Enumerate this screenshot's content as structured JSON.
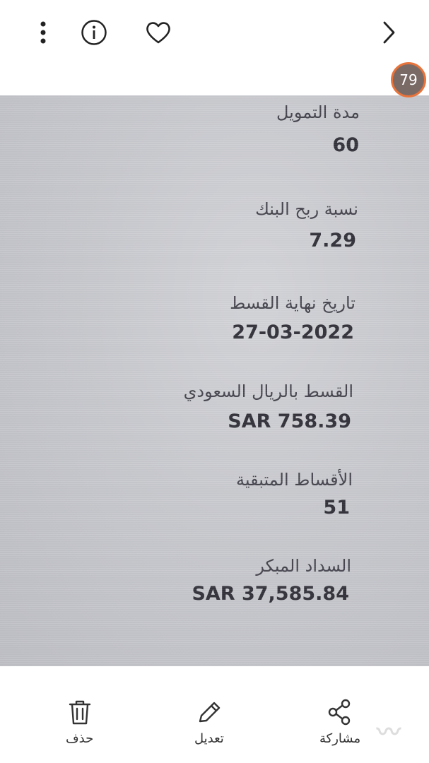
{
  "header": {
    "badge_count": "79",
    "icons": [
      "more-vertical-icon",
      "info-icon",
      "heart-icon",
      "chevron-right-icon"
    ]
  },
  "document": {
    "fields": [
      {
        "label": "مدة التمويل",
        "value": "60"
      },
      {
        "label": "نسبة ربح البنك",
        "value": "7.29"
      },
      {
        "label": "تاريخ نهاية القسط",
        "value": "27-03-2022"
      },
      {
        "label": "القسط بالريال السعودي",
        "value": "SAR 758.39"
      },
      {
        "label": "الأقساط المتبقية",
        "value": "51"
      },
      {
        "label": "السداد المبكر",
        "value": "SAR 37,585.84"
      }
    ]
  },
  "actions": {
    "delete_label": "حذف",
    "edit_label": "تعديل",
    "share_label": "مشاركة"
  },
  "colors": {
    "badge_ring": "#e8743b",
    "badge_fill": "#7a6a66",
    "photo_bg": "#c9cacf",
    "text": "#35343d"
  }
}
